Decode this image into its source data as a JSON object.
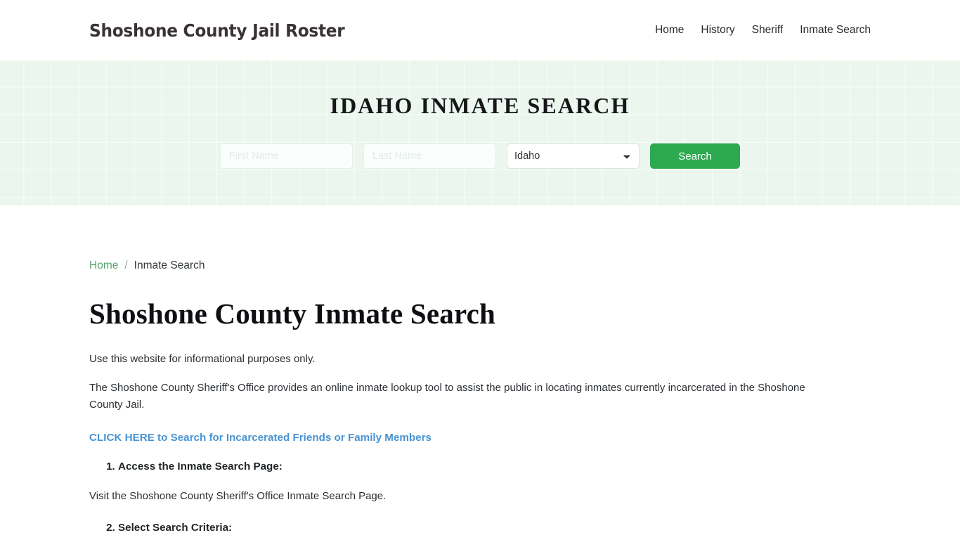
{
  "header": {
    "brand": "Shoshone County Jail Roster",
    "nav": [
      {
        "label": "Home"
      },
      {
        "label": "History"
      },
      {
        "label": "Sheriff"
      },
      {
        "label": "Inmate Search"
      }
    ]
  },
  "hero": {
    "title": "IDAHO INMATE SEARCH",
    "form": {
      "first_name_placeholder": "First Name",
      "first_name_value": "",
      "last_name_placeholder": "Last Name",
      "last_name_value": "",
      "state_selected": "Idaho",
      "state_options": [
        "Idaho"
      ],
      "search_label": "Search"
    },
    "accent_color": "#2da94f",
    "background_color": "#eaf6ee"
  },
  "breadcrumb": {
    "home_label": "Home",
    "separator": "/",
    "current_label": "Inmate Search",
    "link_color": "#57a06f"
  },
  "main": {
    "page_title": "Shoshone County Inmate Search",
    "intro": "Use this website for informational purposes only.",
    "description": "The Shoshone County Sheriff's Office provides an online inmate lookup tool to assist the public in locating inmates currently incarcerated in the Shoshone County Jail.",
    "cta_link": "CLICK HERE to Search for Incarcerated Friends or Family Members",
    "cta_color": "#4a93d1",
    "steps": [
      {
        "number": "1.",
        "label": "Access the Inmate Search Page:",
        "note": "Visit the Shoshone County Sheriff's Office Inmate Search Page."
      },
      {
        "number": "2.",
        "label": "Select Search Criteria:",
        "note": ""
      }
    ]
  }
}
